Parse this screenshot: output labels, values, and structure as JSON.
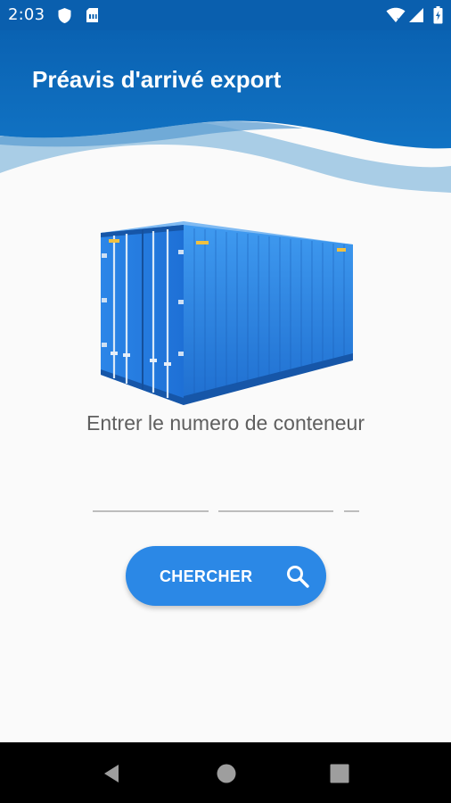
{
  "status_bar": {
    "time": "2:03",
    "icons": [
      "shield-icon",
      "sim-card-icon",
      "wifi-icon",
      "signal-icon",
      "battery-icon"
    ]
  },
  "header": {
    "title": "Préavis d'arrivé export",
    "colors": {
      "primary": "#0a5fae",
      "wave_light": "#a9cde6",
      "wave_mid": "#5d9ed2"
    }
  },
  "main": {
    "illustration": "shipping-container-icon",
    "prompt": "Entrer le numero de conteneur",
    "inputs": [
      {
        "name": "container-prefix",
        "value": "",
        "placeholder": ""
      },
      {
        "name": "container-number",
        "value": "",
        "placeholder": ""
      },
      {
        "name": "container-check-digit",
        "value": "",
        "placeholder": ""
      }
    ],
    "search_button": {
      "label": "CHERCHER",
      "icon": "search-icon",
      "color": "#2b88e6"
    }
  },
  "nav_bar": {
    "buttons": [
      "back-icon",
      "home-icon",
      "recents-icon"
    ]
  }
}
